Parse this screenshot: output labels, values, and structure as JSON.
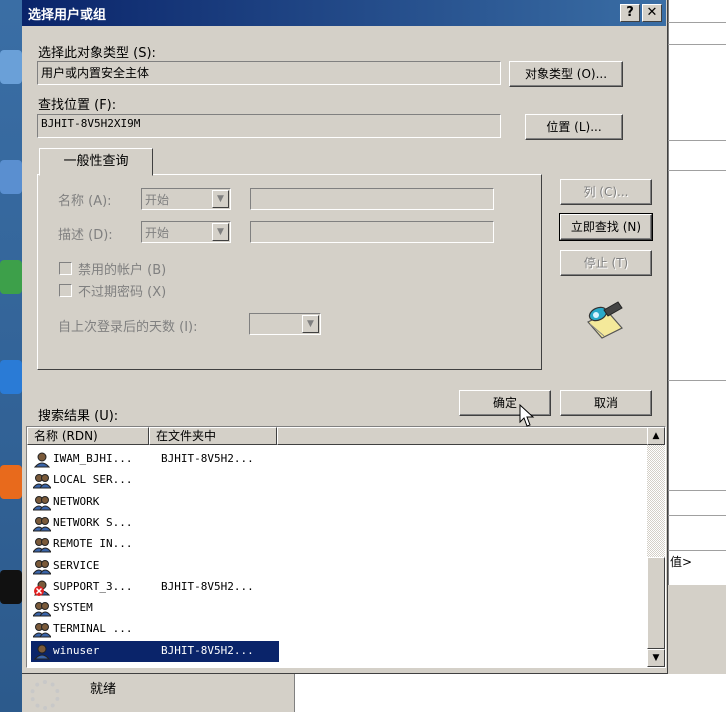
{
  "dialog": {
    "title": "选择用户或组",
    "help_btn": "?",
    "close_btn": "✕"
  },
  "object_type": {
    "label": "选择此对象类型 (S):",
    "value": "用户或内置安全主体",
    "button": "对象类型 (O)..."
  },
  "location": {
    "label": "查找位置 (F):",
    "value": "BJHIT-8V5H2XI9M",
    "button": "位置 (L)..."
  },
  "common_queries": {
    "tab_label": "一般性查询",
    "name_label": "名称 (A):",
    "name_mode": "开始",
    "desc_label": "描述 (D):",
    "desc_mode": "开始",
    "disabled_accounts": "禁用的帐户 (B)",
    "non_expiring_pwd": "不过期密码 (X)",
    "days_since_logon": "自上次登录后的天数 (I):"
  },
  "buttons": {
    "columns": "列 (C)...",
    "find_now": "立即查找 (N)",
    "stop": "停止 (T)",
    "ok": "确定",
    "cancel": "取消"
  },
  "results": {
    "label": "搜索结果 (U):",
    "col_name": "名称 (RDN)",
    "col_folder": "在文件夹中",
    "rows": [
      {
        "name": "IWAM_BJHI...",
        "folder": "BJHIT-8V5H2...",
        "icon": "user-icon"
      },
      {
        "name": "LOCAL SER...",
        "folder": "",
        "icon": "group-icon"
      },
      {
        "name": "NETWORK",
        "folder": "",
        "icon": "group-icon"
      },
      {
        "name": "NETWORK S...",
        "folder": "",
        "icon": "group-icon"
      },
      {
        "name": "REMOTE IN...",
        "folder": "",
        "icon": "group-icon"
      },
      {
        "name": "SERVICE",
        "folder": "",
        "icon": "group-icon"
      },
      {
        "name": "SUPPORT_3...",
        "folder": "BJHIT-8V5H2...",
        "icon": "disabled-user-icon"
      },
      {
        "name": "SYSTEM",
        "folder": "",
        "icon": "group-icon"
      },
      {
        "name": "TERMINAL ...",
        "folder": "",
        "icon": "group-icon"
      },
      {
        "name": "winuser",
        "folder": "BJHIT-8V5H2...",
        "icon": "user-icon"
      }
    ]
  },
  "background": {
    "status": "就绪",
    "value_text": "值>"
  },
  "colors": {
    "title_start": "#0a246a",
    "title_end": "#3a6ea5",
    "selection": "#0a246a",
    "face": "#d4d0c8"
  }
}
